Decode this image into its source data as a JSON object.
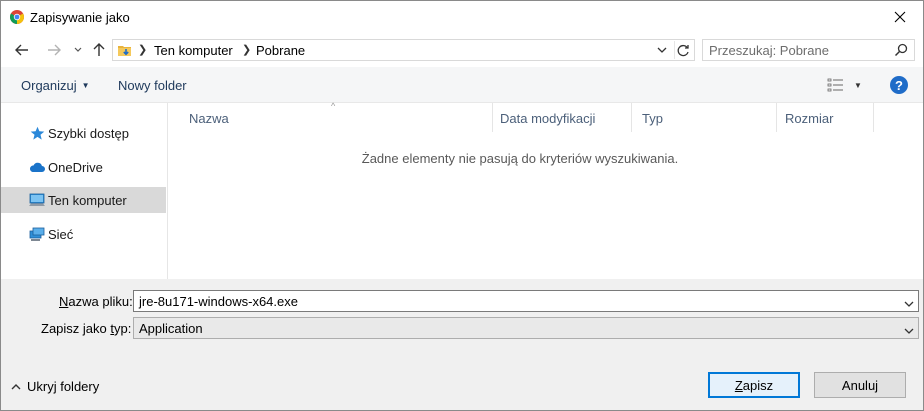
{
  "window": {
    "title": "Zapisywanie jako"
  },
  "nav": {
    "breadcrumb": [
      "Ten komputer",
      "Pobrane"
    ],
    "search_placeholder": "Przeszukaj: Pobrane"
  },
  "toolbar": {
    "organize_label": "Organizuj",
    "new_folder_label": "Nowy folder"
  },
  "sidebar": {
    "items": [
      {
        "label": "Szybki dostęp",
        "icon": "star-icon",
        "selected": false
      },
      {
        "label": "OneDrive",
        "icon": "cloud-icon",
        "selected": false
      },
      {
        "label": "Ten komputer",
        "icon": "computer-icon",
        "selected": true
      },
      {
        "label": "Sieć",
        "icon": "network-icon",
        "selected": false
      }
    ]
  },
  "list": {
    "columns": [
      "Nazwa",
      "Data modyfikacji",
      "Typ",
      "Rozmiar"
    ],
    "empty_message": "Żadne elementy nie pasują do kryteriów wyszukiwania."
  },
  "form": {
    "filename_label_prefix": "N",
    "filename_label_rest": "azwa pliku:",
    "filename_value": "jre-8u171-windows-x64.exe",
    "filetype_label_prefix": "Zapisz jako ",
    "filetype_label_underlined": "t",
    "filetype_label_rest": "yp:",
    "filetype_value": "Application"
  },
  "footer": {
    "hide_folders_label": "Ukryj foldery",
    "save_underlined": "Z",
    "save_rest": "apisz",
    "cancel_label": "Anuluj"
  },
  "colors": {
    "accent": "#0078d7",
    "help": "#1f6cc8",
    "selected_row": "#d9d9d9"
  }
}
